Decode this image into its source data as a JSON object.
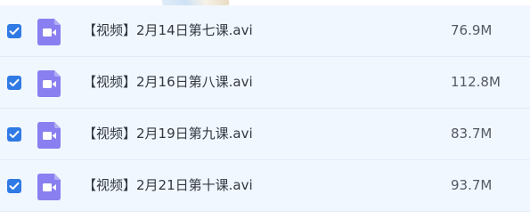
{
  "files": [
    {
      "name": "【视频】2月14日第七课.avi",
      "size": "76.9M",
      "checked": true,
      "icon": "video-camera-icon"
    },
    {
      "name": "【视频】2月16日第八课.avi",
      "size": "112.8M",
      "checked": true,
      "icon": "video-camera-icon"
    },
    {
      "name": "【视频】2月19日第九课.avi",
      "size": "83.7M",
      "checked": true,
      "icon": "video-camera-icon"
    },
    {
      "name": "【视频】2月21日第十课.avi",
      "size": "93.7M",
      "checked": true,
      "icon": "video-camera-icon"
    }
  ],
  "colors": {
    "row_background": "#f1f7ff",
    "checkbox": "#2f7ae5",
    "video_icon": "#8a7ff0"
  }
}
